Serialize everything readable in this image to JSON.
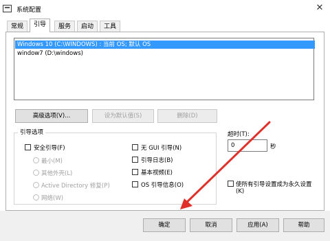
{
  "window": {
    "title": "系统配置",
    "close": "✕"
  },
  "tabs": [
    "常规",
    "引导",
    "服务",
    "启动",
    "工具"
  ],
  "active_tab": "引导",
  "boot_list": [
    "Windows 10 (C:\\WINDOWS) : 当前 OS; 默认 OS",
    "window7 (D:\\windows)"
  ],
  "buttons": {
    "advanced": "高级选项(V)...",
    "set_default": "设为默认值(S)",
    "delete": "删除(D)"
  },
  "boot_options": {
    "group_label": "引导选项",
    "safe_boot": "安全引导(F)",
    "minimal": "最小(M)",
    "alternate_shell": "其他外壳(L)",
    "active_directory": "Active Directory 修复(P)",
    "network": "网络(W)",
    "no_gui": "无 GUI 引导(N)",
    "boot_log": "引导日志(B)",
    "base_video": "基本视频(E)",
    "os_boot_info": "OS 引导信息(O)"
  },
  "timeout": {
    "label": "超时(T):",
    "value": "0",
    "unit": "秒"
  },
  "make_permanent": {
    "line1": "使所有引导设置成为永久设置",
    "line2": "(K)"
  },
  "footer": {
    "ok": "确定",
    "cancel": "取消",
    "apply": "应用(A)",
    "help": "帮助"
  },
  "annotation_color": "#e0302a"
}
